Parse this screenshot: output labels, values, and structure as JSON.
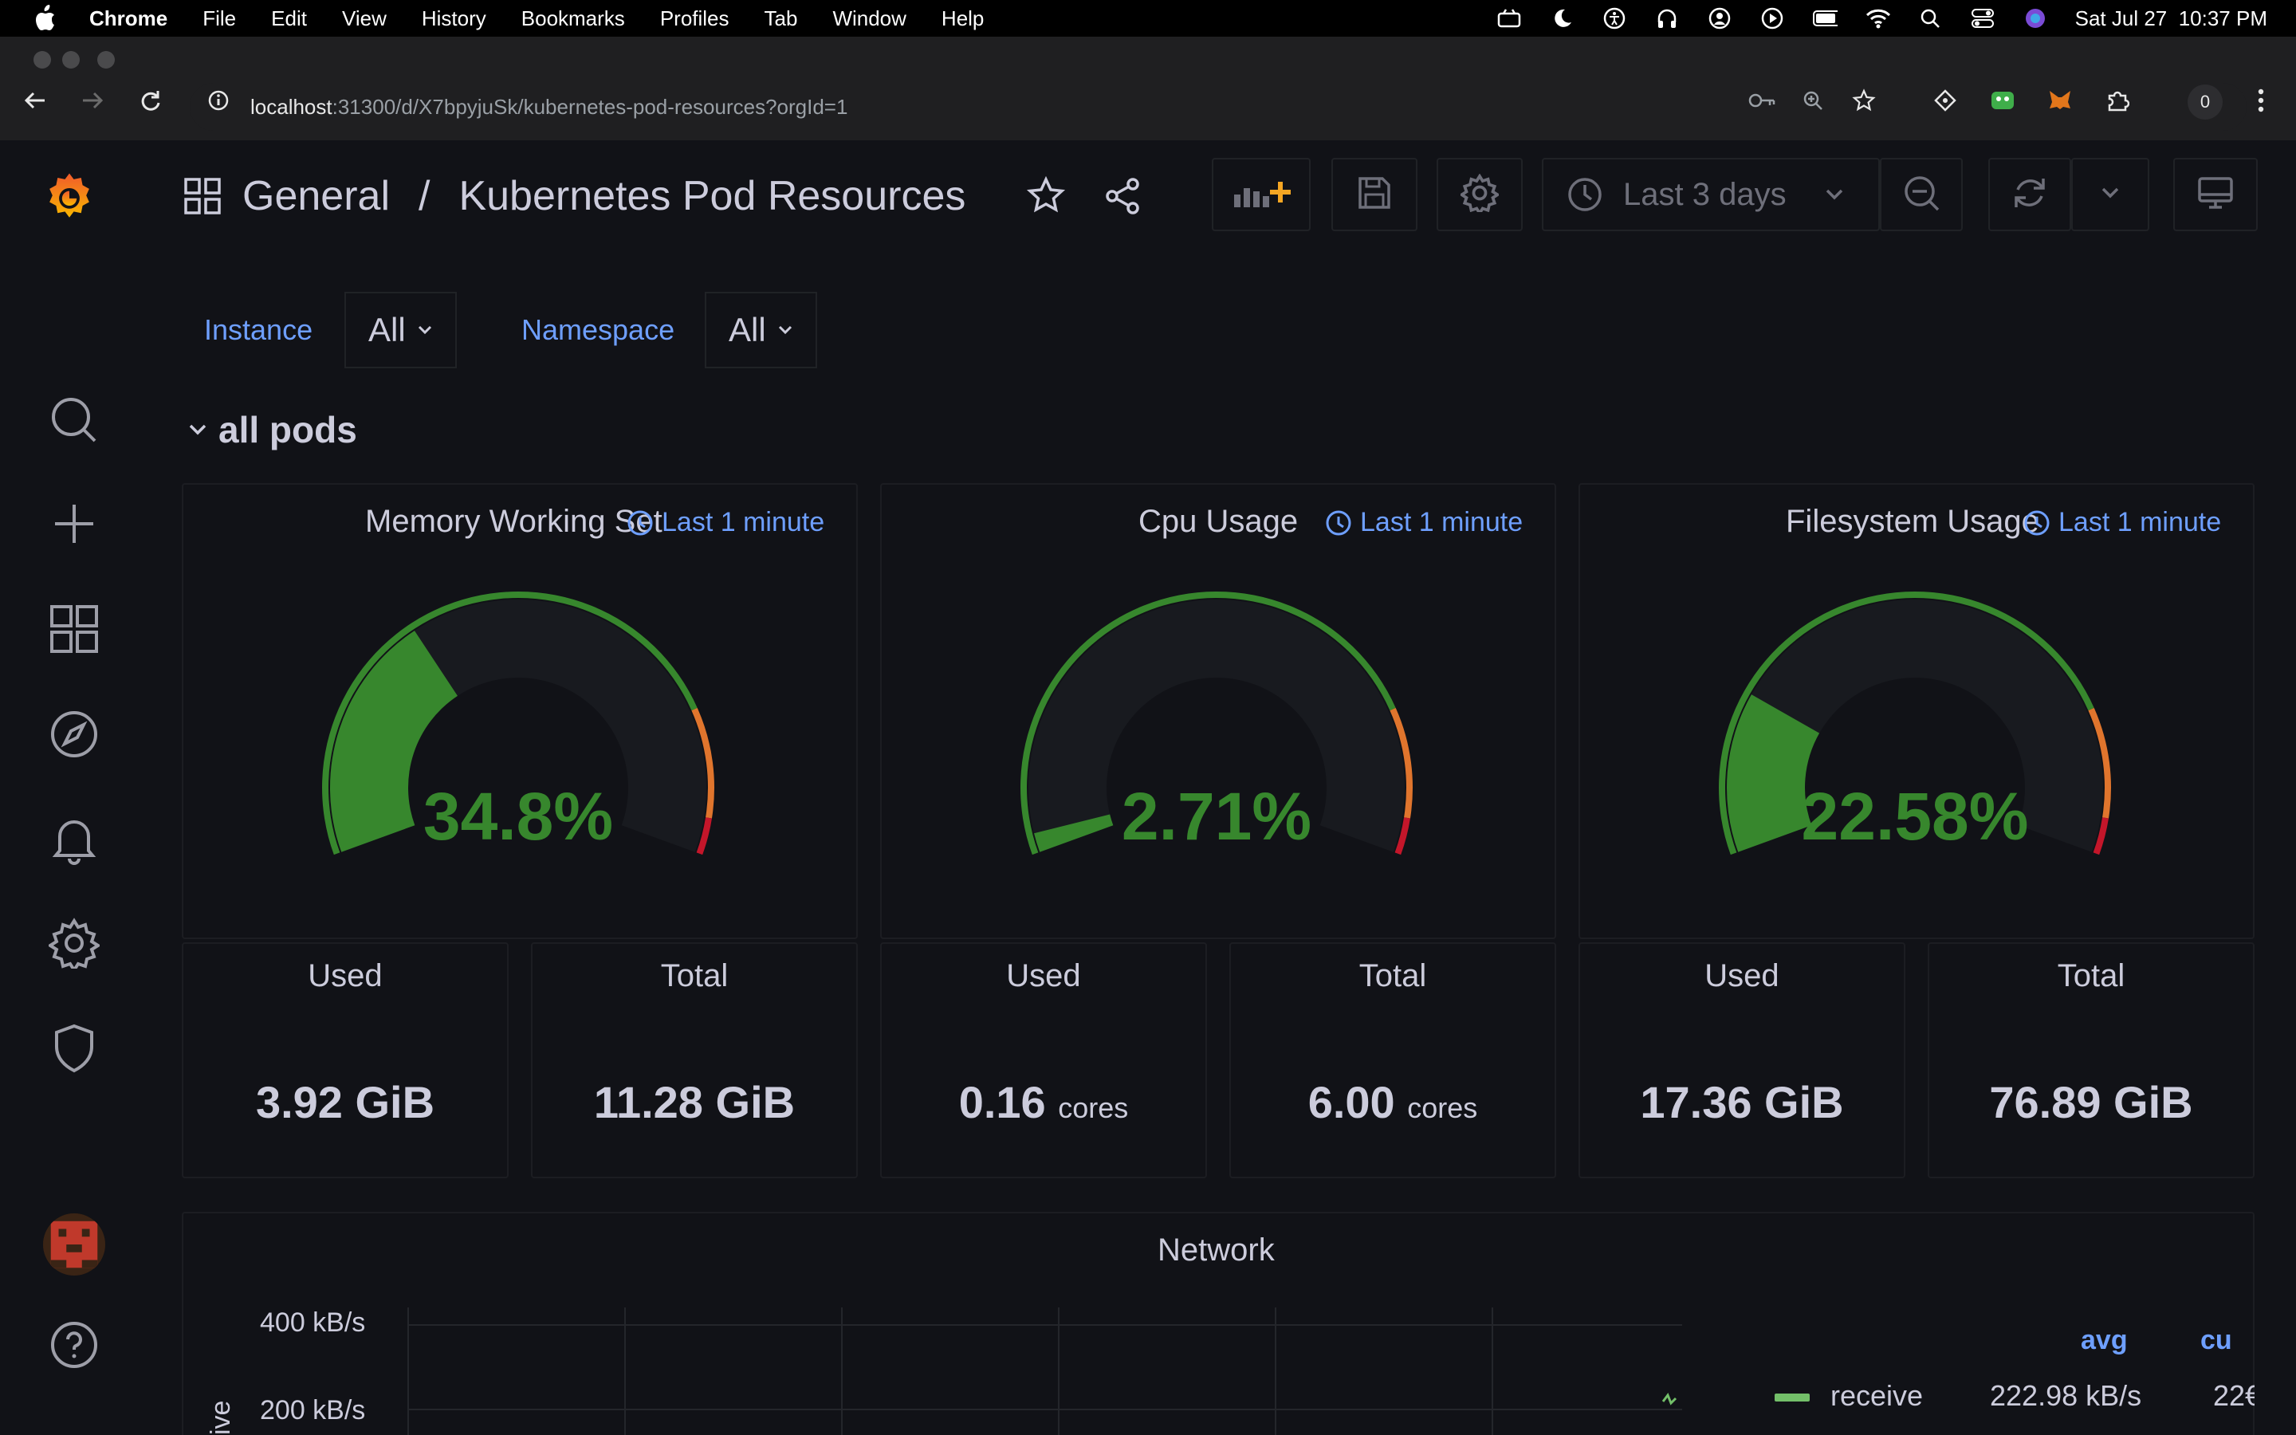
{
  "macos": {
    "menus": [
      "Chrome",
      "File",
      "Edit",
      "View",
      "History",
      "Bookmarks",
      "Profiles",
      "Tab",
      "Window",
      "Help"
    ],
    "clock": "Sat Jul 27  10:37 PM"
  },
  "browser": {
    "url_host": "localhost",
    "url_rest": ":31300/d/X7bpyjuSk/kubernetes-pod-resources?orgId=1",
    "profile_badge": "0"
  },
  "grafana": {
    "breadcrumb_folder": "General",
    "breadcrumb_sep": "/",
    "dashboard_title": "Kubernetes Pod Resources",
    "time_range": "Last 3 days",
    "variables": [
      {
        "label": "Instance",
        "value": "All"
      },
      {
        "label": "Namespace",
        "value": "All"
      }
    ],
    "row_title": "all pods",
    "panels": {
      "memory": {
        "title": "Memory Working Set",
        "time": "Last 1 minute",
        "gauge_value": "34.8%",
        "gauge_fraction": 0.348,
        "used_label": "Used",
        "used_value": "3.92 GiB",
        "total_label": "Total",
        "total_value": "11.28 GiB"
      },
      "cpu": {
        "title": "Cpu Usage",
        "time": "Last 1 minute",
        "gauge_value": "2.71%",
        "gauge_fraction": 0.0271,
        "used_label": "Used",
        "used_value": "0.16",
        "used_unit": "cores",
        "total_label": "Total",
        "total_value": "6.00",
        "total_unit": "cores"
      },
      "fs": {
        "title": "Filesystem Usage",
        "time": "Last 1 minute",
        "gauge_value": "22.58%",
        "gauge_fraction": 0.2258,
        "used_label": "Used",
        "used_value": "17.36 GiB",
        "total_label": "Total",
        "total_value": "76.89 GiB"
      },
      "network": {
        "title": "Network",
        "y_ticks": [
          "400 kB/s",
          "200 kB/s"
        ],
        "y_axis_label": "ive",
        "legend_headers": [
          "avg",
          "cu"
        ],
        "legend_series": "receive",
        "legend_avg": "222.98 kB/s",
        "legend_cur": "22€"
      }
    },
    "colors": {
      "green": "#37872d",
      "orange": "#e0752d",
      "red": "#c4162a",
      "link": "#6e9fff"
    }
  }
}
